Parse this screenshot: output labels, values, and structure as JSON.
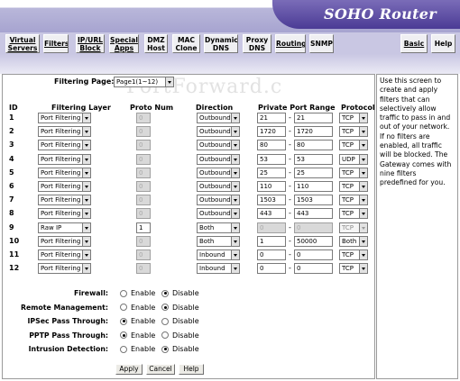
{
  "header": {
    "title": "SOHO Router"
  },
  "nav": [
    {
      "l1": "Virtual",
      "l2": "Servers",
      "link": true
    },
    {
      "l1": "Filters",
      "l2": "",
      "link": true
    },
    {
      "l1": "IP/URL",
      "l2": "Block",
      "link": true
    },
    {
      "l1": "Special",
      "l2": "Apps",
      "link": true
    },
    {
      "l1": "DMZ",
      "l2": "Host",
      "link": false
    },
    {
      "l1": "MAC",
      "l2": "Clone",
      "link": false
    },
    {
      "l1": "Dynamic",
      "l2": "DNS",
      "link": false
    },
    {
      "l1": "Proxy",
      "l2": "DNS",
      "link": false
    },
    {
      "l1": "Routing",
      "l2": "",
      "link": true
    },
    {
      "l1": "SNMP",
      "l2": "",
      "link": false
    },
    {
      "l1": "Basic",
      "l2": "",
      "link": true
    },
    {
      "l1": "Help",
      "l2": "",
      "link": false
    }
  ],
  "watermark": "PortForward.c",
  "filtering_page": {
    "label": "Filtering Page:",
    "value": "Page1(1~12)"
  },
  "table": {
    "headers": [
      "ID",
      "Filtering Layer",
      "Proto Num",
      "Direction",
      "Private Port Range",
      "Protocol"
    ],
    "rows": [
      {
        "id": "1",
        "layer": "Port Filtering",
        "proto": "0",
        "proto_enabled": false,
        "direction": "Outbound",
        "port_from": "21",
        "port_to": "21",
        "ports_enabled": true,
        "protocol": "TCP",
        "protocol_enabled": true
      },
      {
        "id": "2",
        "layer": "Port Filtering",
        "proto": "0",
        "proto_enabled": false,
        "direction": "Outbound",
        "port_from": "1720",
        "port_to": "1720",
        "ports_enabled": true,
        "protocol": "TCP",
        "protocol_enabled": true
      },
      {
        "id": "3",
        "layer": "Port Filtering",
        "proto": "0",
        "proto_enabled": false,
        "direction": "Outbound",
        "port_from": "80",
        "port_to": "80",
        "ports_enabled": true,
        "protocol": "TCP",
        "protocol_enabled": true
      },
      {
        "id": "4",
        "layer": "Port Filtering",
        "proto": "0",
        "proto_enabled": false,
        "direction": "Outbound",
        "port_from": "53",
        "port_to": "53",
        "ports_enabled": true,
        "protocol": "UDP",
        "protocol_enabled": true
      },
      {
        "id": "5",
        "layer": "Port Filtering",
        "proto": "0",
        "proto_enabled": false,
        "direction": "Outbound",
        "port_from": "25",
        "port_to": "25",
        "ports_enabled": true,
        "protocol": "TCP",
        "protocol_enabled": true
      },
      {
        "id": "6",
        "layer": "Port Filtering",
        "proto": "0",
        "proto_enabled": false,
        "direction": "Outbound",
        "port_from": "110",
        "port_to": "110",
        "ports_enabled": true,
        "protocol": "TCP",
        "protocol_enabled": true
      },
      {
        "id": "7",
        "layer": "Port Filtering",
        "proto": "0",
        "proto_enabled": false,
        "direction": "Outbound",
        "port_from": "1503",
        "port_to": "1503",
        "ports_enabled": true,
        "protocol": "TCP",
        "protocol_enabled": true
      },
      {
        "id": "8",
        "layer": "Port Filtering",
        "proto": "0",
        "proto_enabled": false,
        "direction": "Outbound",
        "port_from": "443",
        "port_to": "443",
        "ports_enabled": true,
        "protocol": "TCP",
        "protocol_enabled": true
      },
      {
        "id": "9",
        "layer": "Raw IP",
        "proto": "1",
        "proto_enabled": true,
        "direction": "Both",
        "port_from": "0",
        "port_to": "0",
        "ports_enabled": false,
        "protocol": "TCP",
        "protocol_enabled": false
      },
      {
        "id": "10",
        "layer": "Port Filtering",
        "proto": "0",
        "proto_enabled": false,
        "direction": "Both",
        "port_from": "1",
        "port_to": "50000",
        "ports_enabled": true,
        "protocol": "Both",
        "protocol_enabled": true
      },
      {
        "id": "11",
        "layer": "Port Filtering",
        "proto": "0",
        "proto_enabled": false,
        "direction": "Inbound",
        "port_from": "0",
        "port_to": "0",
        "ports_enabled": true,
        "protocol": "TCP",
        "protocol_enabled": true
      },
      {
        "id": "12",
        "layer": "Port Filtering",
        "proto": "0",
        "proto_enabled": false,
        "direction": "Inbound",
        "port_from": "0",
        "port_to": "0",
        "ports_enabled": true,
        "protocol": "TCP",
        "protocol_enabled": true
      }
    ]
  },
  "options": [
    {
      "label": "Firewall:",
      "enable": "Enable",
      "disable": "Disable",
      "selected": "Disable"
    },
    {
      "label": "Remote Management:",
      "enable": "Enable",
      "disable": "Disable",
      "selected": "Disable"
    },
    {
      "label": "IPSec Pass Through:",
      "enable": "Enable",
      "disable": "Disable",
      "selected": "Enable"
    },
    {
      "label": "PPTP Pass Through:",
      "enable": "Enable",
      "disable": "Disable",
      "selected": "Enable"
    },
    {
      "label": "Intrusion Detection:",
      "enable": "Enable",
      "disable": "Disable",
      "selected": "Disable"
    }
  ],
  "buttons": {
    "apply": "Apply",
    "cancel": "Cancel",
    "help": "Help"
  },
  "side_help": "Use this screen to create and apply filters that can selectively allow traffic to pass in and out of your network. If no filters are enabled, all traffic will be blocked. The Gateway comes with nine filters predefined for you."
}
